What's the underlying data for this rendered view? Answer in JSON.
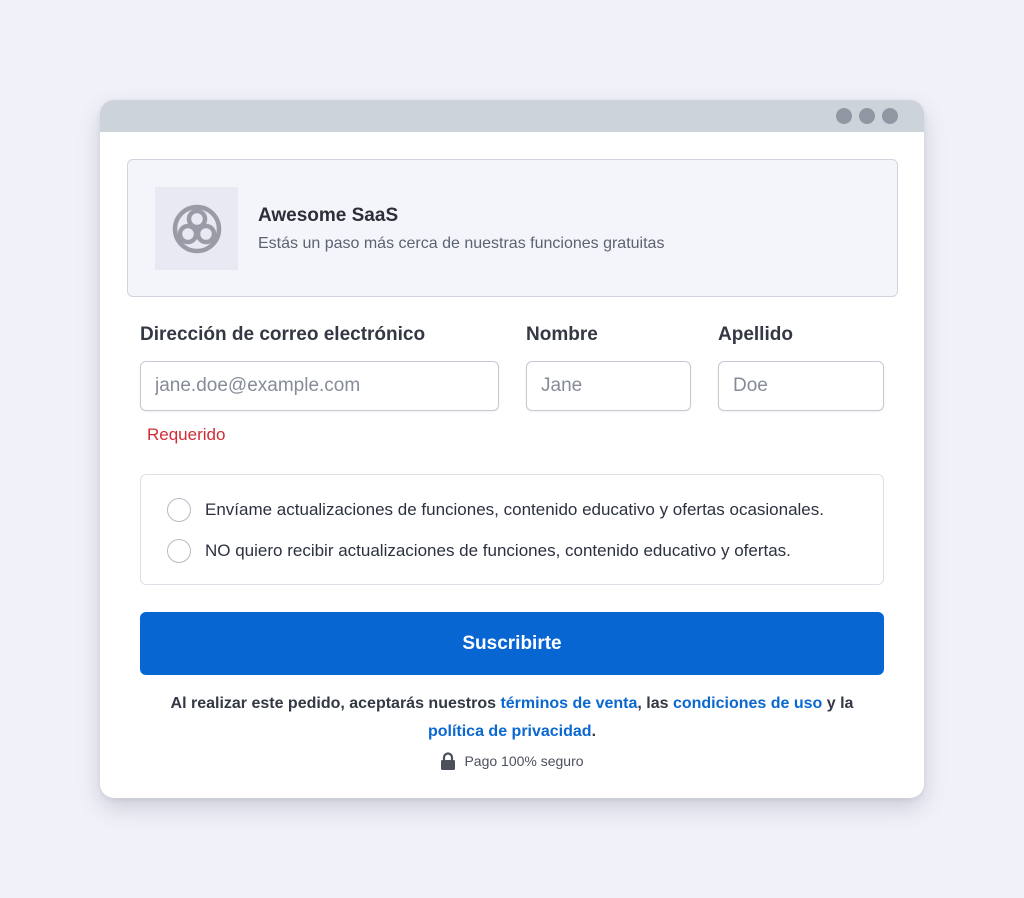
{
  "product": {
    "name": "Awesome SaaS",
    "subtitle": "Estás un paso más cerca de nuestras funciones gratuitas",
    "logo_icon": "triple-circle-logo-icon"
  },
  "form": {
    "email": {
      "label": "Dirección de correo electrónico",
      "placeholder": "jane.doe@example.com",
      "value": "",
      "error": "Requerido"
    },
    "first_name": {
      "label": "Nombre",
      "placeholder": "Jane",
      "value": ""
    },
    "last_name": {
      "label": "Apellido",
      "placeholder": "Doe",
      "value": ""
    },
    "options": [
      {
        "label": "Envíame actualizaciones de funciones, contenido educativo y ofertas ocasionales.",
        "checked": false
      },
      {
        "label": "NO quiero recibir actualizaciones de funciones, contenido educativo y ofertas.",
        "checked": false
      }
    ],
    "submit_label": "Suscribirte"
  },
  "legal": {
    "prefix": "Al realizar este pedido, aceptarás nuestros ",
    "terms_of_sale": "términos de venta",
    "sep1": ", las ",
    "terms_of_use": "condiciones de uso",
    "sep2": " y la ",
    "privacy": "política de privacidad",
    "suffix": ".",
    "secure_text": "Pago 100% seguro",
    "secure_icon": "lock-icon"
  },
  "colors": {
    "primary": "#0866d3",
    "link": "#0a68d0",
    "error": "#d02c35",
    "titlebar": "#ccd3db",
    "background": "#f1f2f9"
  }
}
